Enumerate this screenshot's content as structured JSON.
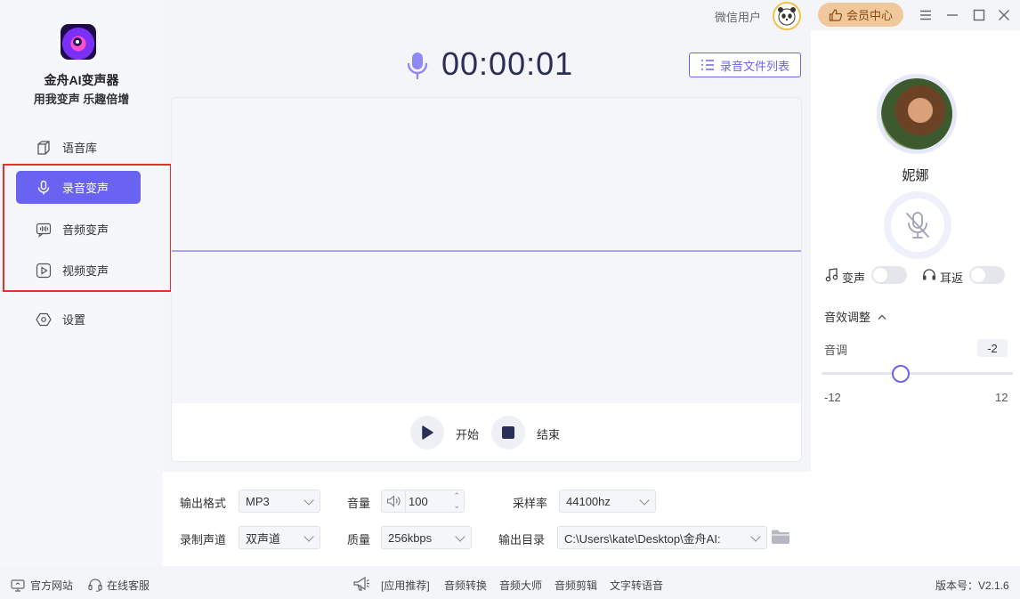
{
  "app": {
    "name": "金舟AI变声器",
    "slogan": "用我变声 乐趣倍增"
  },
  "sidebar": {
    "items": [
      {
        "label": "语音库",
        "icon": "cube-icon"
      },
      {
        "label": "录音变声",
        "icon": "microphone-icon",
        "active": true
      },
      {
        "label": "音频变声",
        "icon": "audio-wave-icon"
      },
      {
        "label": "视频变声",
        "icon": "play-icon"
      },
      {
        "label": "设置",
        "icon": "hexagon-settings-icon"
      }
    ]
  },
  "topbar": {
    "user_label": "微信用户",
    "vip_label": "会员中心"
  },
  "recorder": {
    "timer": "00:00:01",
    "file_list_label": "录音文件列表",
    "start_label": "开始",
    "stop_label": "结束"
  },
  "settings": {
    "output_format_label": "输出格式",
    "output_format_value": "MP3",
    "volume_label": "音量",
    "volume_value": "100",
    "sample_rate_label": "采样率",
    "sample_rate_value": "44100hz",
    "channel_label": "录制声道",
    "channel_value": "双声道",
    "quality_label": "质量",
    "quality_value": "256kbps",
    "output_dir_label": "输出目录",
    "output_dir_value": "C:\\Users\\kate\\Desktop\\金舟AI:"
  },
  "voice_panel": {
    "voice_name": "妮娜",
    "voice_change_label": "变声",
    "earback_label": "耳返",
    "effects_label": "音效调整",
    "pitch_label": "音调",
    "pitch_value": "-2",
    "pitch_fraction": 0.4,
    "pitch_min": "-12",
    "pitch_max": "12"
  },
  "footer": {
    "website_label": "官方网站",
    "support_label": "在线客服",
    "recommend_label": "[应用推荐]",
    "links": [
      "音频转换",
      "音频大师",
      "音频剪辑",
      "文字转语音"
    ],
    "version_label": "版本号：V2.1.6"
  },
  "colors": {
    "accent": "#6a63f2",
    "annotation_red": "#e8302a",
    "vip": "#f1c89b"
  }
}
